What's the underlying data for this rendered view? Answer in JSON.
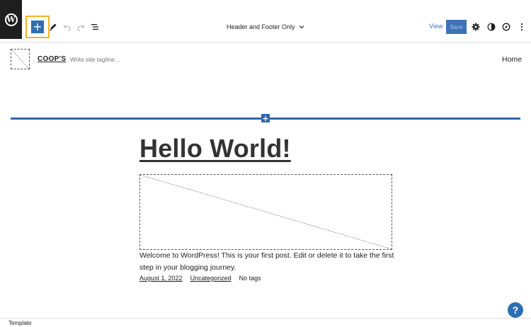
{
  "toolbar": {
    "wp_logo_glyph": "W",
    "inserter_glyph": "+",
    "icons": [
      "wordpress-logo",
      "plus-icon",
      "pencil-icon",
      "undo-icon",
      "redo-icon",
      "list-view-icon",
      "chevron-down-icon",
      "gear-icon",
      "styles-icon",
      "navigation-icon",
      "more-options-icon"
    ],
    "template_name": "Header and Footer Only",
    "view_label": "View",
    "save_label": "Save",
    "accent_color": "#2f6fb1",
    "highlight_color": "#f0b429"
  },
  "header": {
    "site_title": "COOP'S",
    "tagline_placeholder": "Write site tagline…",
    "nav_items": [
      "Home"
    ]
  },
  "separator": {
    "insert_glyph": "+"
  },
  "post": {
    "title": "Hello World!",
    "excerpt": "Welcome to WordPress! This is your first post. Edit or delete it to take the first step in your blogging journey.",
    "date": "August 1, 2022",
    "category": "Uncategorized",
    "tags": "No tags"
  },
  "footer": {
    "breadcrumb": "Template",
    "help_glyph": "?"
  }
}
